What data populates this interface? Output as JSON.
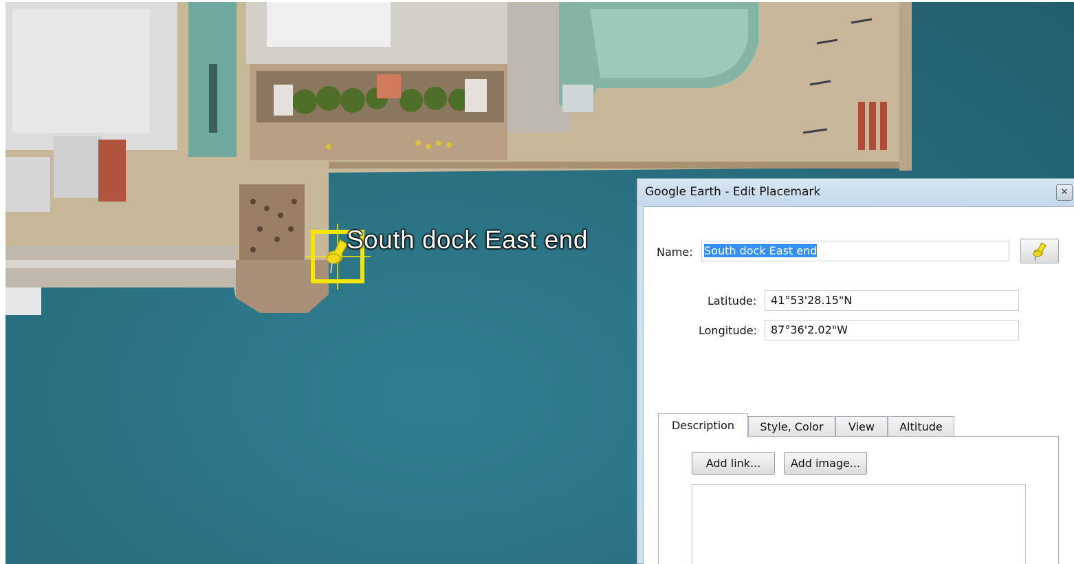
{
  "map": {
    "placemark_label": "South dock East end",
    "pin_marker_icon": "pushpin-icon",
    "pin_color": "#f5e11c",
    "selection_box_color": "#f5e600",
    "water_color": "#2b6f80"
  },
  "dialog": {
    "title": "Google Earth - Edit Placemark",
    "close_icon": "close-icon",
    "name_label": "Name:",
    "name_value": "South dock East end",
    "icon_button_icon": "pushpin-icon",
    "latitude_label": "Latitude:",
    "latitude_value": "41°53'28.15\"N",
    "longitude_label": "Longitude:",
    "longitude_value": "87°36'2.02\"W",
    "tabs": [
      {
        "label": "Description",
        "active": true
      },
      {
        "label": "Style, Color",
        "active": false
      },
      {
        "label": "View",
        "active": false
      },
      {
        "label": "Altitude",
        "active": false
      }
    ],
    "add_link_label": "Add link...",
    "add_image_label": "Add image...",
    "description_value": "",
    "selection_color": "#3390ff"
  }
}
